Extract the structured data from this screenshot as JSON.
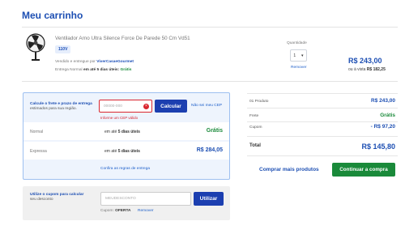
{
  "page": {
    "title": "Meu carrinho"
  },
  "product": {
    "image_icon": "fan-image",
    "name": "Ventilador Arno Ultra Silence Force De Parede 50 Cm Vd51",
    "voltage": "110V",
    "seller_prefix": "Vendido e entregue por",
    "seller_name": "ViverCasaeGourmet",
    "delivery_prefix": "Entrega Normal",
    "delivery_time": "em até 5 dias úteis:",
    "delivery_cost": "Grátis",
    "quantity_label": "Quantidade",
    "quantity": "1",
    "remove_label": "Remover",
    "price": "R$ 243,00",
    "price_vista_prefix": "ou à vista",
    "price_vista": "R$ 182,25"
  },
  "shipping": {
    "title": "Calcule o frete e prazo de entrega",
    "subtitle": "estimados para sua região.",
    "cep_placeholder": "00000-000",
    "error_text": "Informe um CEP válido",
    "calc_button": "Calcular",
    "dont_know": "Não sei meu CEP",
    "options": [
      {
        "name": "Normal",
        "time_prefix": "em até",
        "time": "5 dias úteis",
        "price": "Grátis"
      },
      {
        "name": "Expressa",
        "time_prefix": "em até",
        "time": "5 dias úteis",
        "price": "R$ 284,05"
      }
    ],
    "rules_link": "Confira as regras de entrega"
  },
  "coupon": {
    "title": "Utilize o cupom para calcular",
    "subtitle": "seu desconto",
    "placeholder": "MEUDESCONTO",
    "button": "Utilizar",
    "code_prefix": "Cupom:",
    "code": "OFERTA",
    "remove": "Remover"
  },
  "summary": {
    "rows": [
      {
        "label": "01 Produto",
        "value": "R$ 243,00"
      },
      {
        "label": "Frete",
        "value": "Grátis"
      },
      {
        "label": "Cupom",
        "value": "- R$ 97,20"
      }
    ],
    "total_label": "Total",
    "total_value": "R$ 145,80",
    "more_products": "Comprar mais produtos",
    "continue_button": "Continuar a compra"
  },
  "colors": {
    "brand_blue": "#1d4fb3",
    "button_blue": "#1c3fb0",
    "green": "#1a8a3a",
    "error_red": "#d9262f"
  }
}
